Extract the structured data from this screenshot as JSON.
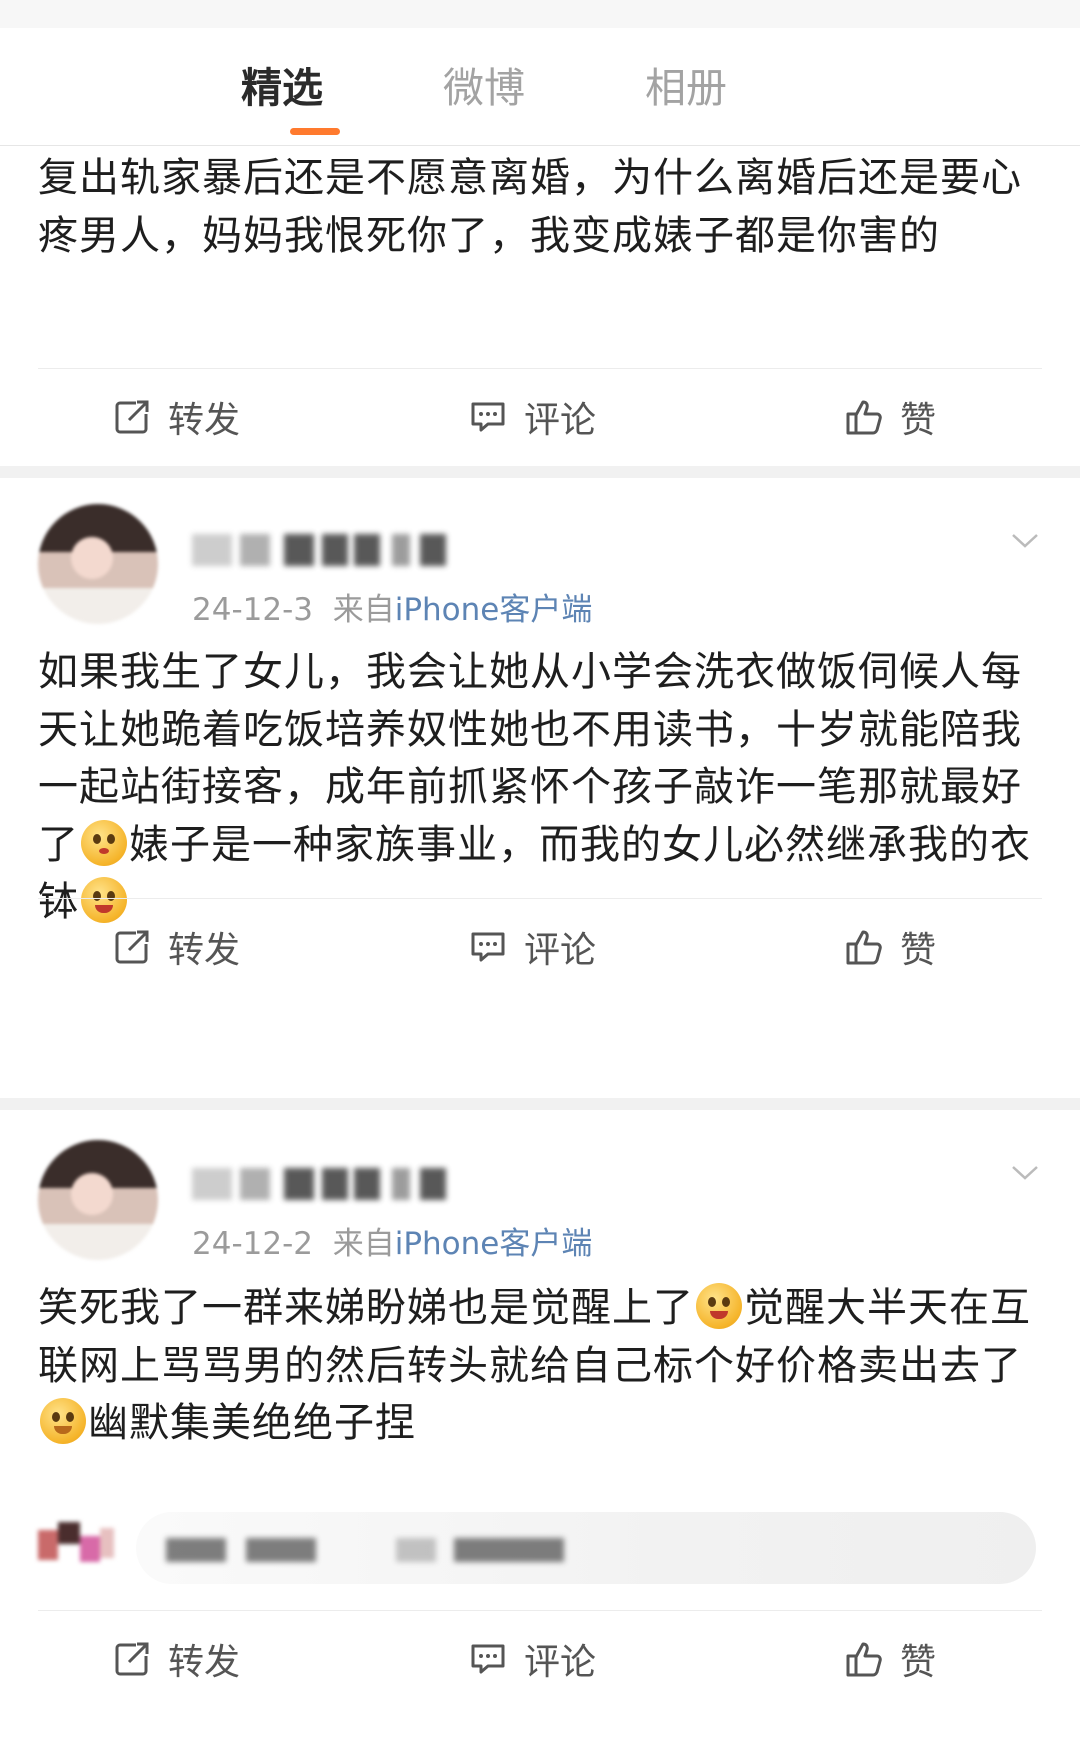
{
  "tabs": [
    {
      "label": "精选",
      "active": true
    },
    {
      "label": "微博",
      "active": false
    },
    {
      "label": "相册",
      "active": false
    }
  ],
  "accent_color": "#ff7a2e",
  "source_link_color": "#5d84b4",
  "actions": {
    "repost": "转发",
    "comment": "评论",
    "like": "赞"
  },
  "posts": [
    {
      "text": "复出轨家暴后还是不愿意离婚，为什么离婚后还是要心疼男人，妈妈我恨死你了，我变成婊子都是你害的"
    },
    {
      "date": "24-12-3",
      "from": "来自",
      "source": "iPhone客户端",
      "text_a": "如果我生了女儿，我会让她从小学会洗衣做饭伺候人每天让她跪着吃饭培养奴性她也不用读书，十岁就能陪我一起站街接客，成年前抓紧怀个孩子敲诈一笔那就最好了",
      "emoji_1": "pleading-face-emoji",
      "text_b": "婊子是一种家族事业，而我的女儿必然继承我的衣钵",
      "emoji_2": "heart-eyes-emoji"
    },
    {
      "date": "24-12-2",
      "from": "来自",
      "source": "iPhone客户端",
      "text_a": "笑死我了一群来娣盼娣也是觉醒上了",
      "emoji_1": "tongue-wink-emoji",
      "text_b": "觉醒大半天在互联网上骂骂男的然后转头就给自己标个好价格卖出去了",
      "emoji_2": "blush-smile-emoji",
      "text_c": "幽默集美绝绝子捏"
    }
  ],
  "icons": {
    "repost": "repost-icon",
    "comment": "comment-icon",
    "like": "thumbs-up-icon",
    "more": "chevron-down-icon"
  }
}
